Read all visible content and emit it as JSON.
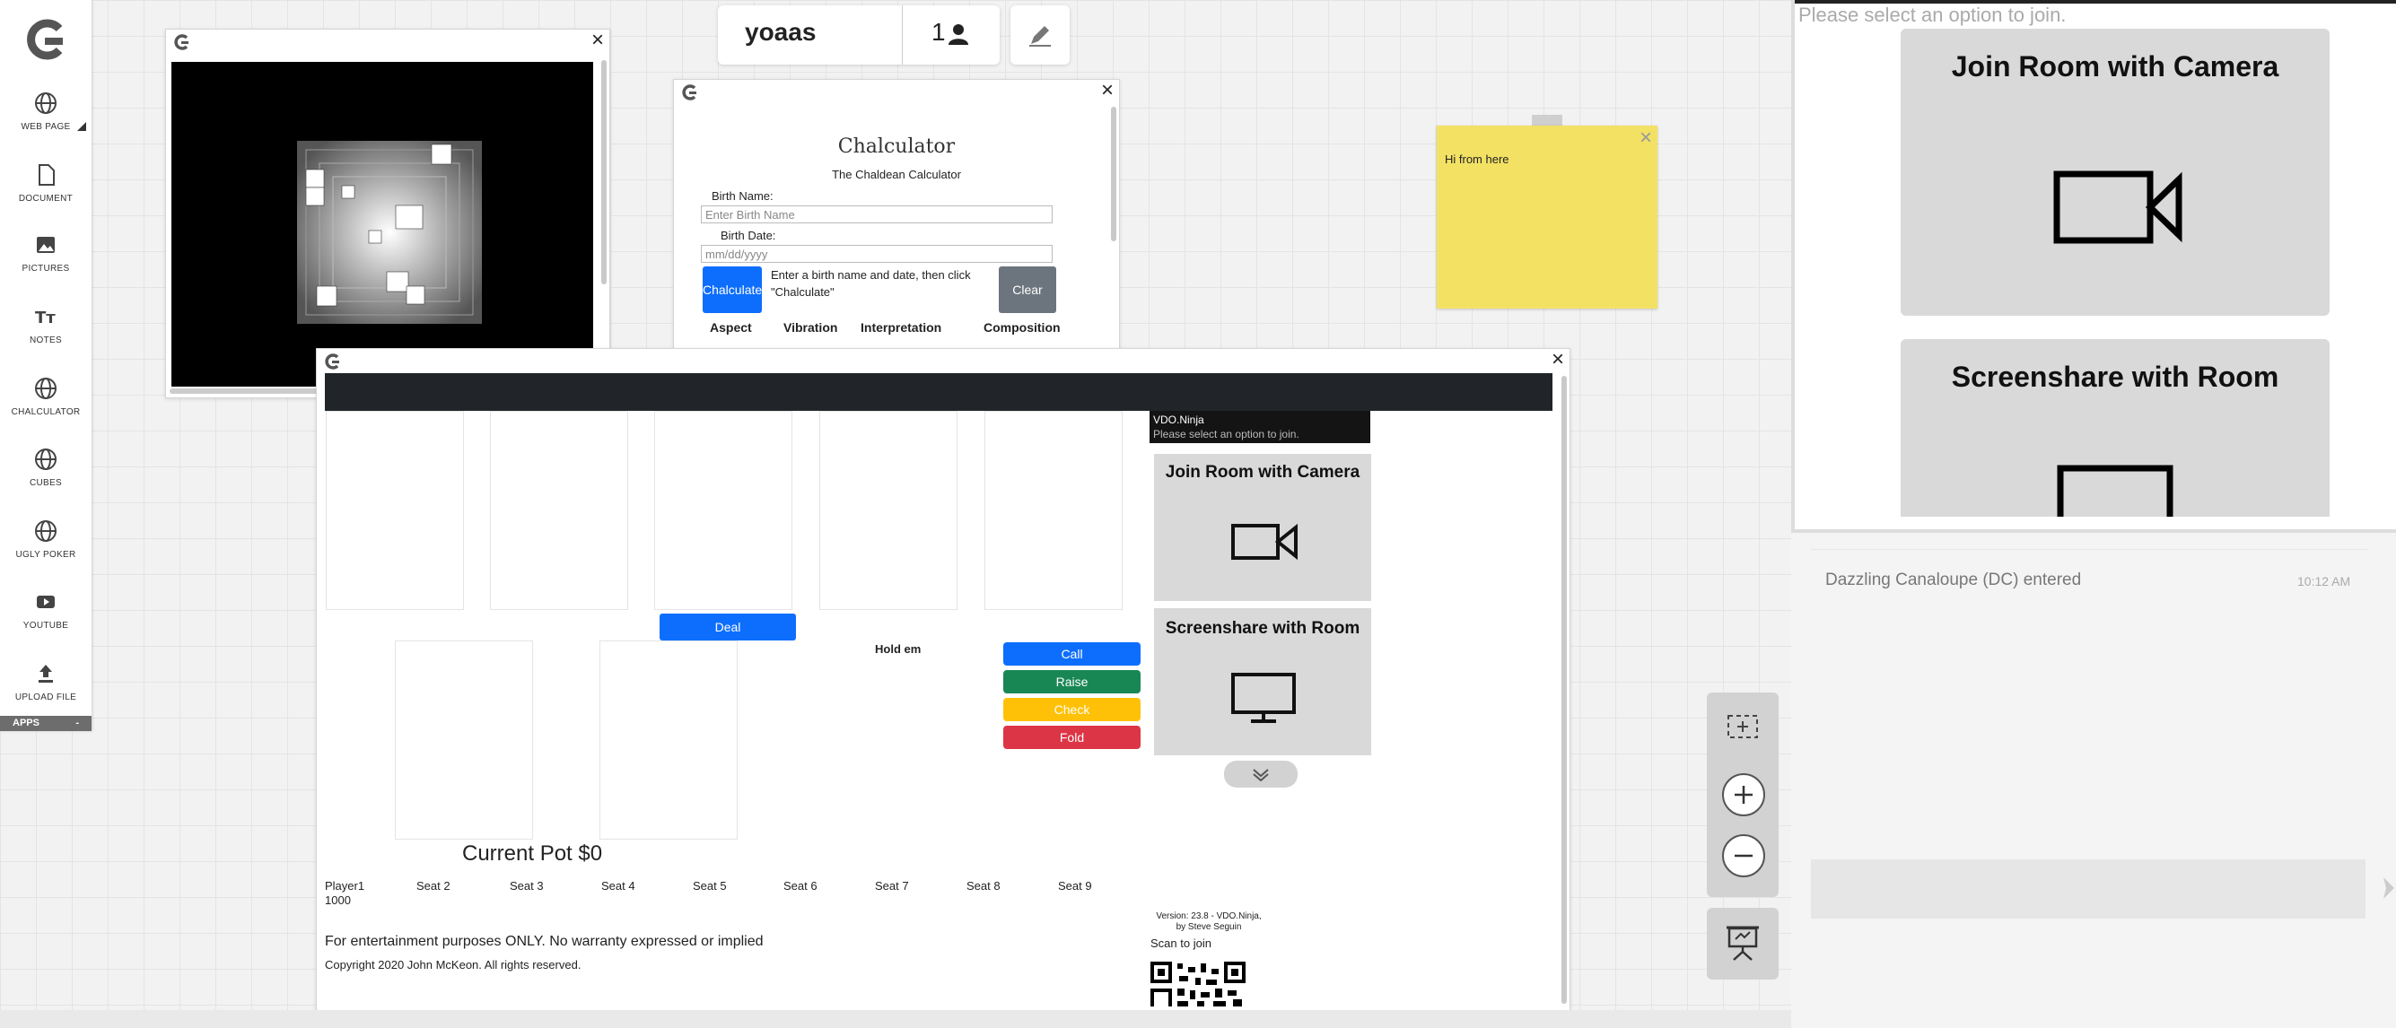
{
  "sidebar": {
    "items": [
      {
        "label": "WEB PAGE",
        "icon": "globe-icon"
      },
      {
        "label": "DOCUMENT",
        "icon": "document-icon"
      },
      {
        "label": "PICTURES",
        "icon": "picture-icon"
      },
      {
        "label": "NOTES",
        "icon": "text-icon"
      },
      {
        "label": "CHALCULATOR",
        "icon": "globe-icon"
      },
      {
        "label": "CUBES",
        "icon": "globe-icon"
      },
      {
        "label": "UGLY POKER",
        "icon": "globe-icon"
      },
      {
        "label": "YOUTUBE",
        "icon": "youtube-icon"
      },
      {
        "label": "UPLOAD FILE",
        "icon": "upload-icon"
      }
    ],
    "apps_label": "APPS",
    "apps_toggle": "-"
  },
  "topbar": {
    "room_name": "yoaas",
    "user_count": "1"
  },
  "chalculator": {
    "title": "Chalculator",
    "subtitle": "The Chaldean Calculator",
    "birth_name_label": "Birth Name:",
    "birth_name_placeholder": "Enter Birth Name",
    "birth_date_label": "Birth Date:",
    "birth_date_placeholder": "mm/dd/yyyy",
    "calculate_label": "Chalculate",
    "instruction": "Enter a birth name and date, then click \"Chalculate\"",
    "clear_label": "Clear",
    "columns": [
      "Aspect",
      "Vibration",
      "Interpretation",
      "Composition"
    ]
  },
  "sticky_note": {
    "text": "Hi from here",
    "close": "×"
  },
  "poker": {
    "deal_label": "Deal",
    "game_label": "Hold em",
    "actions": [
      {
        "label": "Call",
        "color": "#0d6efd"
      },
      {
        "label": "Raise",
        "color": "#198754"
      },
      {
        "label": "Check",
        "color": "#ffc107"
      },
      {
        "label": "Fold",
        "color": "#dc3545"
      }
    ],
    "pot": "Current Pot $0",
    "seats": [
      "Player1",
      "Seat 2",
      "Seat 3",
      "Seat 4",
      "Seat 5",
      "Seat 6",
      "Seat 7",
      "Seat 8",
      "Seat 9"
    ],
    "player1_chips": "1000",
    "disclaimer": "For entertainment purposes ONLY. No warranty expressed or implied",
    "copyright": "Copyright 2020 John McKeon. All rights reserved.",
    "vdo_title": "VDO.Ninja",
    "vdo_prompt": "Please select an option to join.",
    "join_camera": "Join Room with Camera",
    "screenshare": "Screenshare with Room",
    "version": "Version: 23.8 - VDO.Ninja, by Steve Seguin",
    "scan": "Scan to join"
  },
  "right_panel": {
    "prompt": "Please select an option to join.",
    "join_camera": "Join Room with Camera",
    "screenshare": "Screenshare with Room"
  },
  "chat": {
    "message": "Dazzling Canaloupe (DC) entered",
    "time": "10:12 AM"
  },
  "colors": {
    "accent": "#0d6efd",
    "sticky": "#f3e164",
    "dark_bar": "#212529"
  }
}
